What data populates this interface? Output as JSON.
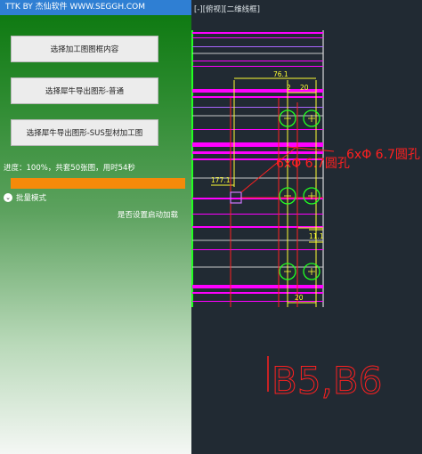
{
  "app": {
    "title": "TTK BY 杰仙软件 WWW.SEGGH.COM"
  },
  "buttons": {
    "select_frame": "选择加工图图框内容",
    "export_normal": "选择犀牛导出图形-普通",
    "export_sus": "选择犀牛导出图形-SUS型材加工图"
  },
  "progress": {
    "text": "进度：100%，共套50张图，用时54秒",
    "percent": 100
  },
  "batch_mode": {
    "label": "批量模式"
  },
  "auto_load": {
    "label": "是否设置启动加载"
  },
  "cad": {
    "viewport_label": "[-][俯视][二维线框]",
    "dims": {
      "d76": "76.1",
      "d2": "2",
      "d20top": "20",
      "d177": "177.1",
      "d11": "11.1",
      "d20bot": "20"
    },
    "annotations": {
      "holes_a": "6xΦ 6.7圆孔",
      "holes_b": "6xΦ 6.7圆孔",
      "part_id": "B5,B6"
    },
    "colors": {
      "magenta": "#ff00ff",
      "red": "#ff2020",
      "green": "#22ff22",
      "yellow": "#ffff33",
      "cyan": "#34e0e0"
    }
  }
}
